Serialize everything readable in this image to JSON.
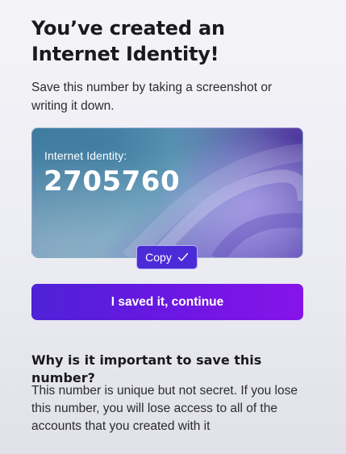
{
  "header": {
    "title": "You’ve created an Internet Identity!",
    "subtitle": "Save this number by taking a screenshot or writing it down."
  },
  "identity_card": {
    "label": "Internet Identity:",
    "number": "2705760"
  },
  "copy_button": {
    "label": "Copy",
    "icon": "check-icon"
  },
  "primary_button": {
    "label": "I saved it, continue"
  },
  "info": {
    "title": "Why is it important to save this number?",
    "body": "This number is unique but not secret. If you lose this number, you will lose access to all of the accounts that you created with it"
  },
  "colors": {
    "accent": "#4b2bd8",
    "button_gradient_start": "#4e22d6",
    "button_gradient_end": "#8714e8"
  }
}
